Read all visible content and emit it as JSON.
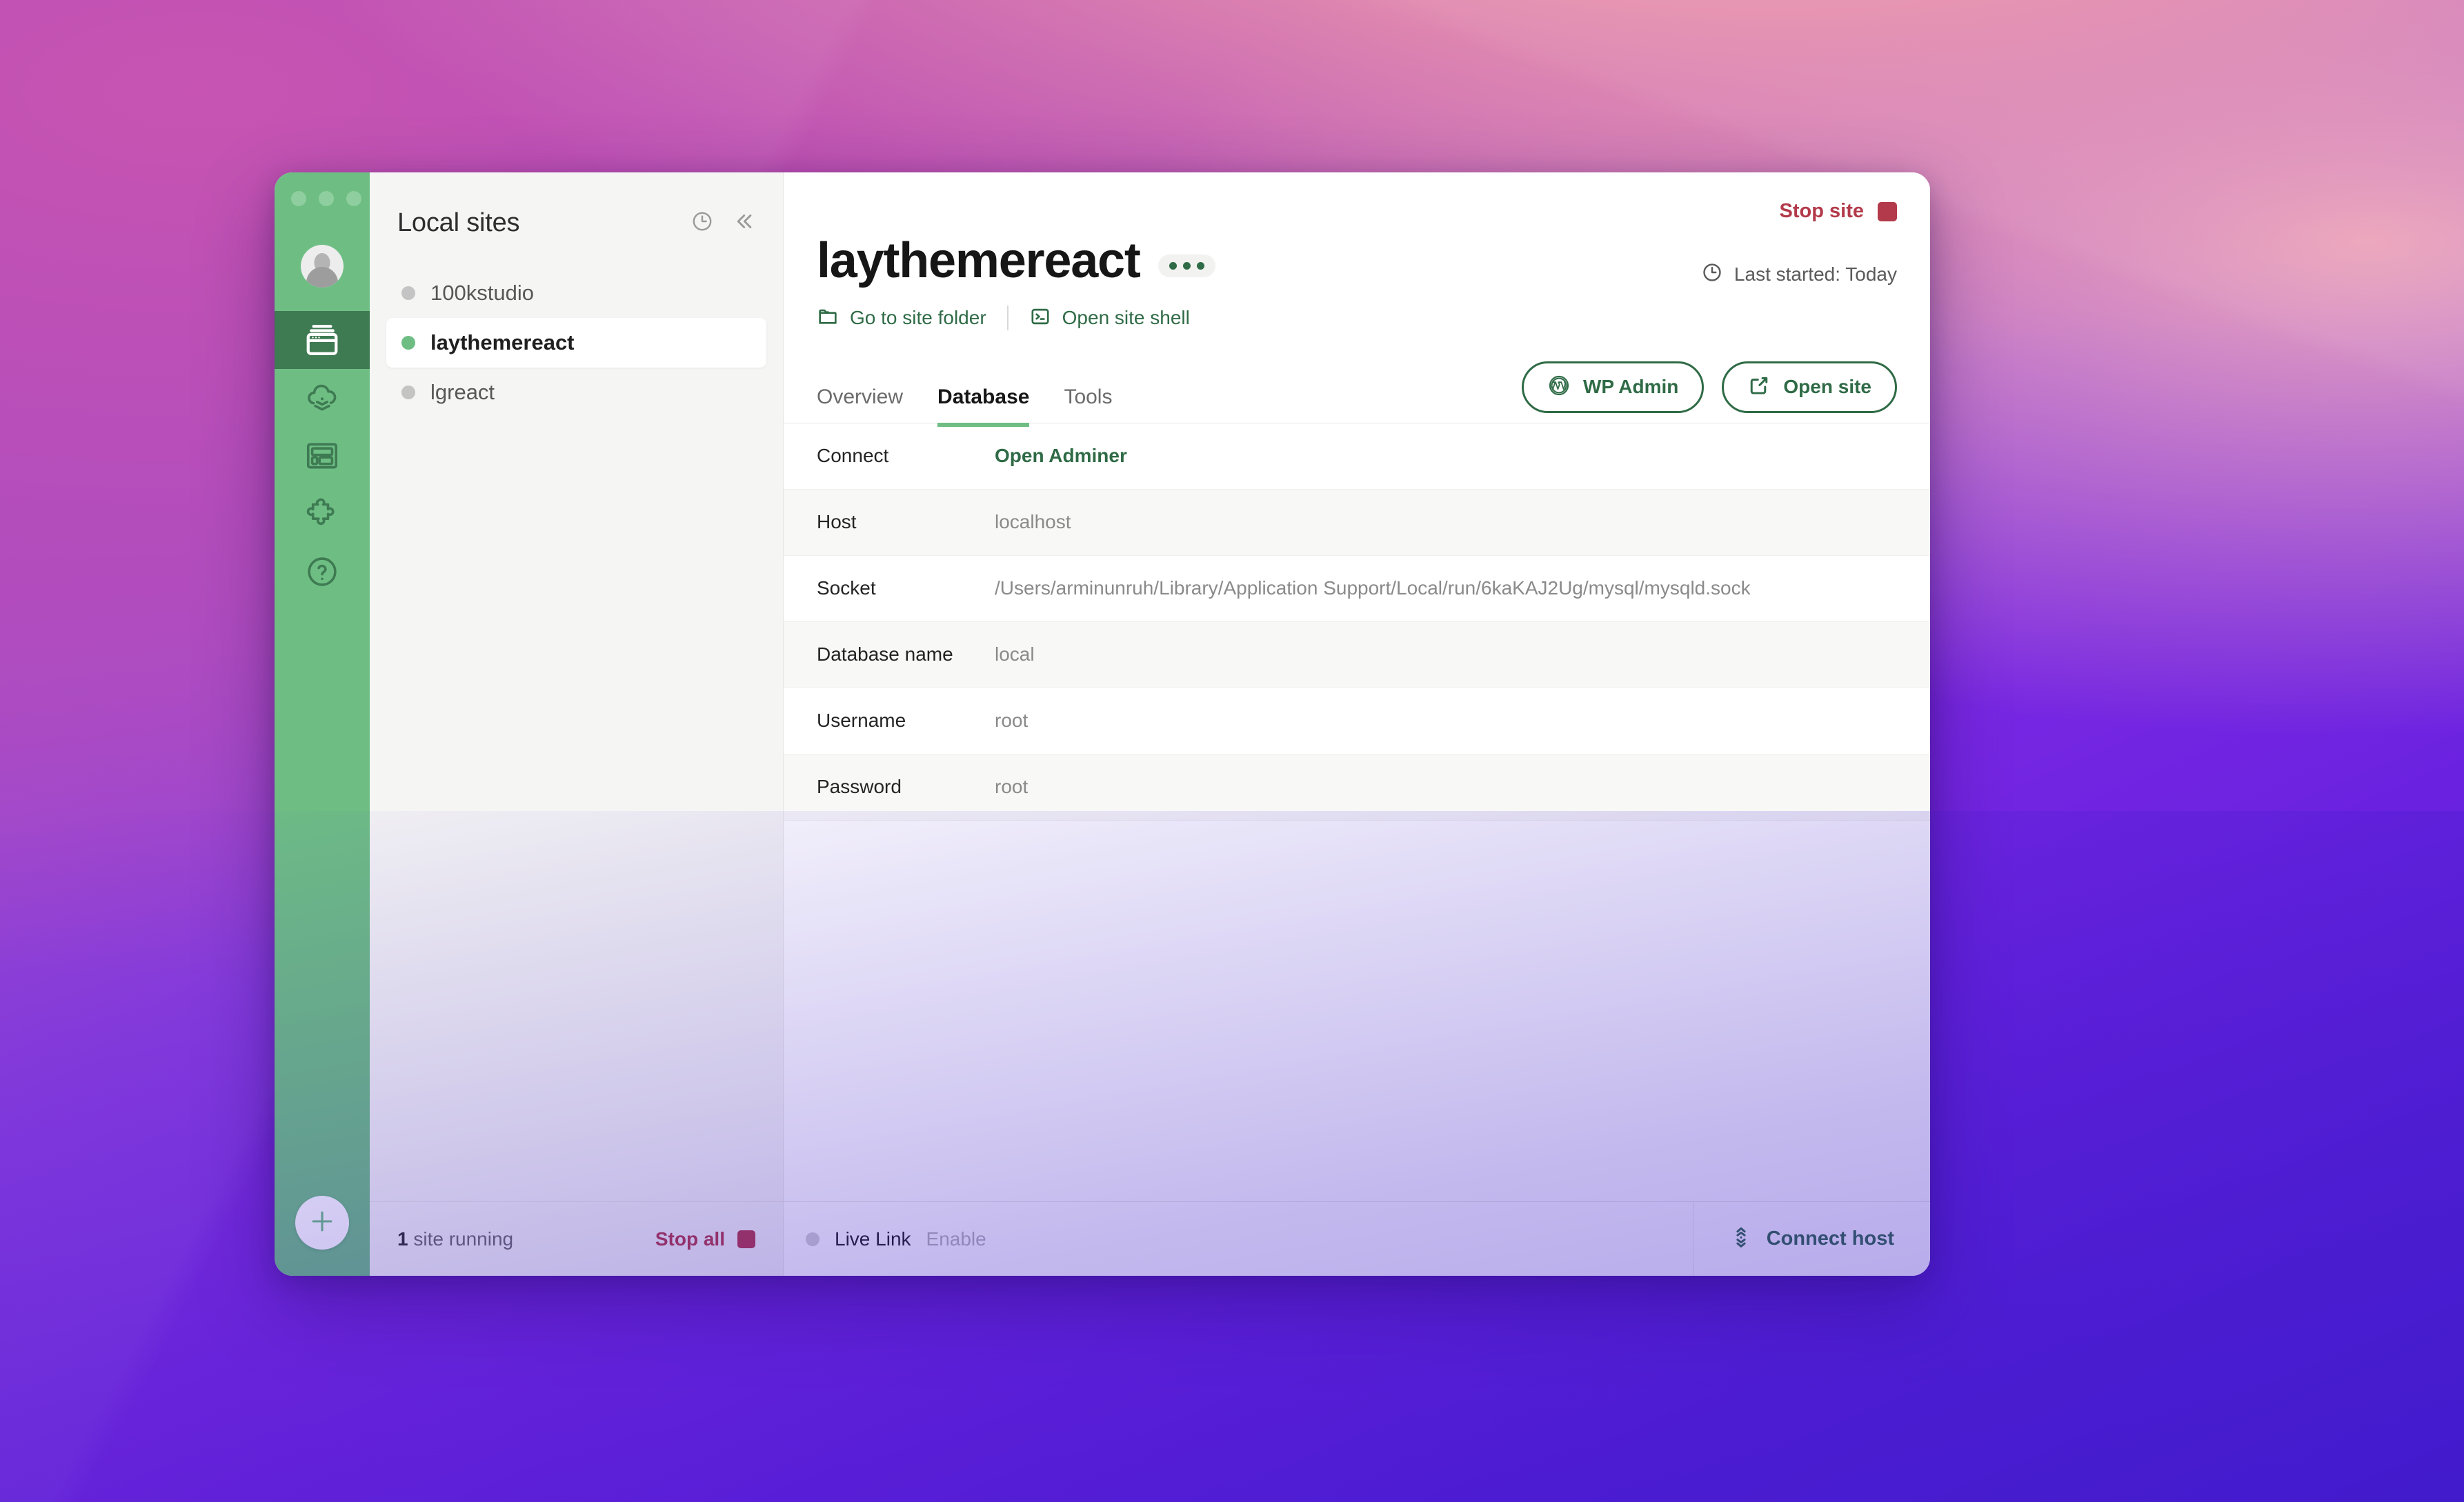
{
  "window": {
    "traffic_lights": [
      "close",
      "minimize",
      "maximize"
    ]
  },
  "icon_rail": {
    "items": [
      {
        "name": "sites-icon",
        "label": "Sites",
        "active": true
      },
      {
        "name": "cloud-backups-icon",
        "label": "Cloud Backups",
        "active": false
      },
      {
        "name": "blueprints-icon",
        "label": "Blueprints",
        "active": false
      },
      {
        "name": "add-ons-icon",
        "label": "Add-ons",
        "active": false
      },
      {
        "name": "help-icon",
        "label": "Help",
        "active": false
      }
    ],
    "add_button_label": "+"
  },
  "sidebar": {
    "title": "Local sites",
    "history_icon": "clock-icon",
    "collapse_icon": "chevron-double-left-icon",
    "sites": [
      {
        "name": "100kstudio",
        "running": false,
        "selected": false
      },
      {
        "name": "laythemereact",
        "running": true,
        "selected": true
      },
      {
        "name": "lgreact",
        "running": false,
        "selected": false
      }
    ],
    "footer": {
      "running_count_value": "1",
      "running_count_suffix": "site running",
      "stop_all_label": "Stop all"
    }
  },
  "main": {
    "stop_site_label": "Stop site",
    "site_title": "laythemereact",
    "overflow_menu_icon": "ellipsis-icon",
    "quick_links": [
      {
        "label": "Go to site folder",
        "icon": "folder-icon"
      },
      {
        "label": "Open site shell",
        "icon": "terminal-icon"
      }
    ],
    "last_started": {
      "icon": "clock-icon",
      "label": "Last started: Today"
    },
    "tabs": [
      {
        "label": "Overview",
        "active": false
      },
      {
        "label": "Database",
        "active": true
      },
      {
        "label": "Tools",
        "active": false
      }
    ],
    "action_buttons": [
      {
        "label": "WP Admin",
        "icon": "wordpress-icon"
      },
      {
        "label": "Open site",
        "icon": "external-link-icon"
      }
    ],
    "database": {
      "rows": [
        {
          "label": "Connect",
          "value": "Open Adminer",
          "is_link": true,
          "striped": false
        },
        {
          "label": "Host",
          "value": "localhost",
          "is_link": false,
          "striped": true
        },
        {
          "label": "Socket",
          "value": "/Users/arminunruh/Library/Application Support/Local/run/6kaKAJ2Ug/mysql/mysqld.sock",
          "is_link": false,
          "striped": false
        },
        {
          "label": "Database name",
          "value": "local",
          "is_link": false,
          "striped": true
        },
        {
          "label": "Username",
          "value": "root",
          "is_link": false,
          "striped": false
        },
        {
          "label": "Password",
          "value": "root",
          "is_link": false,
          "striped": true
        }
      ]
    },
    "footer": {
      "live_link_label": "Live Link",
      "live_link_enable": "Enable",
      "connect_host_label": "Connect host",
      "connect_host_icon": "connect-host-icon"
    }
  },
  "colors": {
    "brand_green": "#6EBE84",
    "dark_green": "#2F6B46",
    "rail_active": "#3E7A52",
    "danger_red": "#B33A4B",
    "sidebar_bg": "#F5F5F4"
  }
}
